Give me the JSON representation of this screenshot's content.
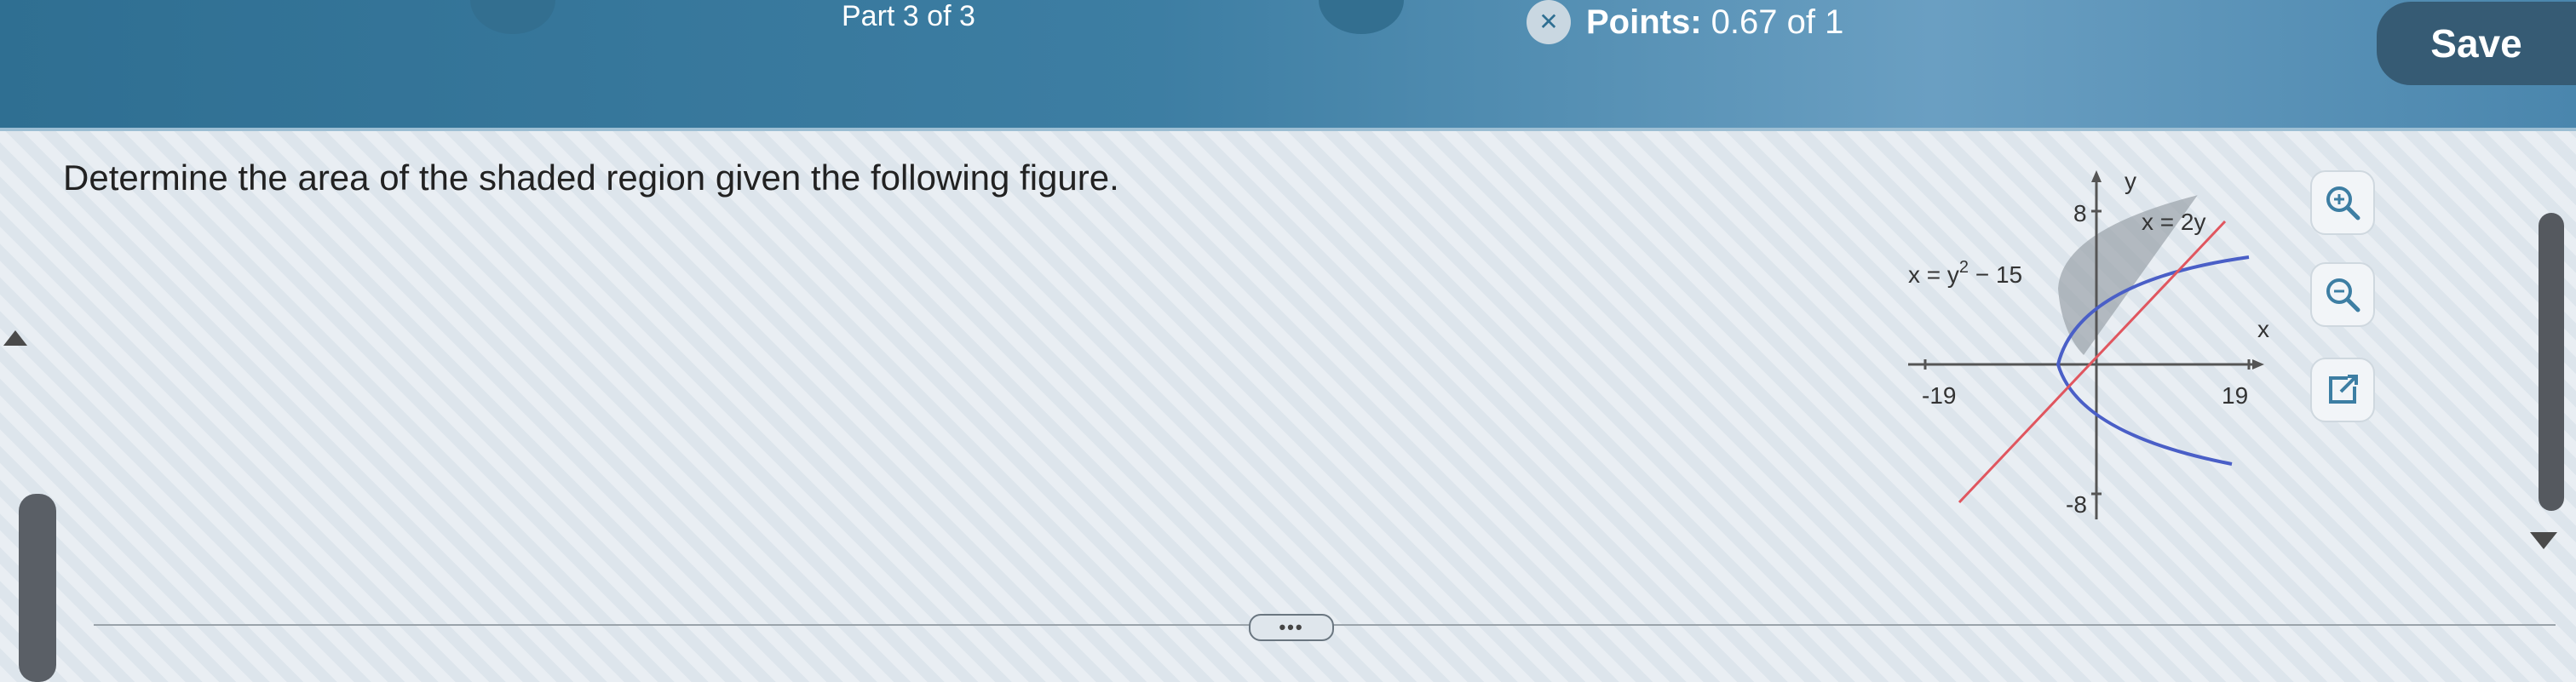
{
  "header": {
    "part": "Part 3 of 3",
    "points_label": "Points:",
    "points_value": "0.67 of 1",
    "save_label": "Save"
  },
  "question": {
    "text": "Determine the area of the shaded region given the following figure."
  },
  "figure": {
    "curve1_label": "x = y",
    "curve1_exponent": "2",
    "curve1_rest": " − 15",
    "line_label": "x = 2y",
    "axis_x": "x",
    "axis_y": "y",
    "tick_x_neg": "-19",
    "tick_x_pos": "19",
    "tick_y_pos": "8",
    "tick_y_neg": "-8"
  },
  "tools": {
    "zoom_in": "zoom-in-icon",
    "zoom_out": "zoom-out-icon",
    "open_new": "open-in-new-icon"
  },
  "more_label": "•••",
  "colors": {
    "header_bg": "#3d7ea3",
    "save_bg": "#365b74",
    "curve_blue": "#4a5fc7",
    "line_red": "#e0565f",
    "shade": "#9aa3aa"
  }
}
